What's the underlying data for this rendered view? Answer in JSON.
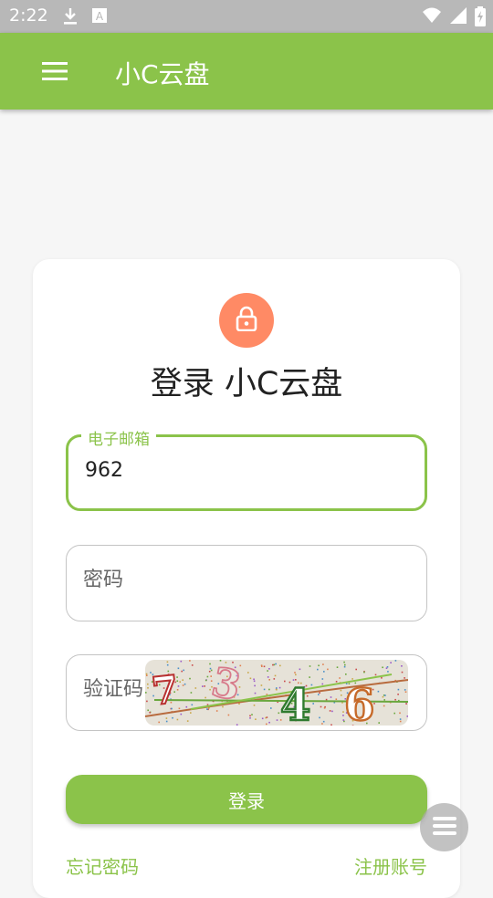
{
  "status_bar": {
    "time": "2:22",
    "left_icons": [
      "download-icon",
      "text-badge-icon"
    ],
    "right_icons": [
      "wifi-icon",
      "signal-icon",
      "battery-charging-icon"
    ]
  },
  "app_bar": {
    "menu_icon": "hamburger-menu-icon",
    "title": "小C云盘",
    "background": "#8bc34a"
  },
  "login_card": {
    "avatar_icon": "lock-icon",
    "avatar_color": "#ff8a65",
    "title": "登录 小C云盘",
    "email": {
      "label": "电子邮箱",
      "value": "962"
    },
    "password": {
      "placeholder": "密码"
    },
    "captcha": {
      "placeholder": "验证码",
      "image_digits": [
        "7",
        "3",
        "4",
        "6"
      ]
    },
    "login_button": "登录",
    "forgot_password": "忘记密码",
    "register": "注册账号"
  },
  "floating_button": {
    "icon": "stacked-lines-icon"
  },
  "colors": {
    "accent": "#8bc34a",
    "avatar": "#ff8a65",
    "status_bar": "#b8b8b8"
  }
}
